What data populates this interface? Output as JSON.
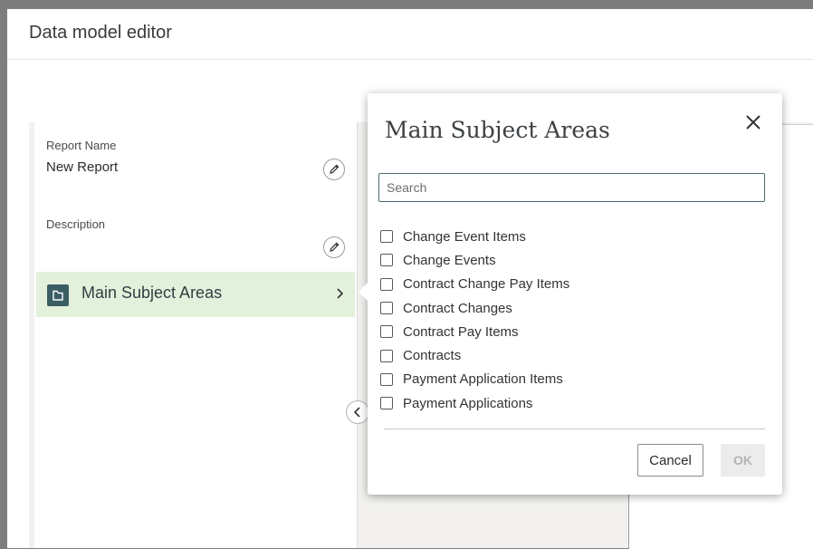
{
  "dialog": {
    "title": "Data model editor"
  },
  "report": {
    "name_label": "Report Name",
    "name_value": "New Report",
    "description_label": "Description",
    "description_value": ""
  },
  "subject_row": {
    "label": "Main Subject Areas",
    "icon": "folder-icon"
  },
  "popup": {
    "title": "Main Subject Areas",
    "search_placeholder": "Search",
    "search_value": "",
    "items": [
      {
        "label": "Change Event Items",
        "checked": false
      },
      {
        "label": "Change Events",
        "checked": false
      },
      {
        "label": "Contract Change Pay Items",
        "checked": false
      },
      {
        "label": "Contract Changes",
        "checked": false
      },
      {
        "label": "Contract Pay Items",
        "checked": false
      },
      {
        "label": "Contracts",
        "checked": false
      },
      {
        "label": "Payment Application Items",
        "checked": false
      },
      {
        "label": "Payment Applications",
        "checked": false
      }
    ],
    "cancel_label": "Cancel",
    "ok_label": "OK"
  },
  "colors": {
    "accent": "#3a5c63",
    "selected_row": "#e3f1dc",
    "overlay": "#7d7d7d"
  }
}
